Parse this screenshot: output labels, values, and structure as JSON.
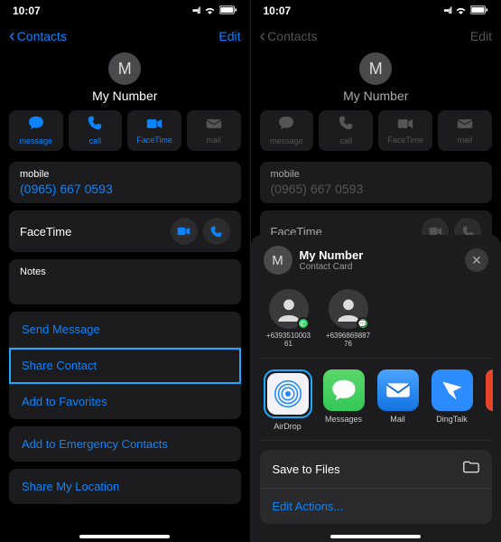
{
  "left": {
    "status": {
      "time": "10:07"
    },
    "nav": {
      "back": "Contacts",
      "edit": "Edit"
    },
    "avatar_initial": "M",
    "title": "My Number",
    "actions": {
      "message": "message",
      "call": "call",
      "facetime": "FaceTime",
      "mail": "mail"
    },
    "mobile": {
      "label": "mobile",
      "value": "(0965) 667 0593"
    },
    "facetime_label": "FaceTime",
    "notes_label": "Notes",
    "list1": {
      "send_message": "Send Message",
      "share_contact": "Share Contact",
      "add_favorites": "Add to Favorites"
    },
    "list2": {
      "emergency": "Add to Emergency Contacts"
    },
    "list3": {
      "share_location": "Share My Location"
    }
  },
  "right": {
    "status": {
      "time": "10:07"
    },
    "nav": {
      "back": "Contacts",
      "edit": "Edit"
    },
    "avatar_initial": "M",
    "title": "My Number",
    "actions": {
      "message": "message",
      "call": "call",
      "facetime": "FaceTime",
      "mail": "mail"
    },
    "mobile": {
      "label": "mobile",
      "value": "(0965) 667 0593"
    },
    "facetime_label": "FaceTime",
    "share": {
      "avatar_initial": "M",
      "title": "My Number",
      "subtitle": "Contact Card",
      "airdrop_contacts": [
        {
          "label": "+639351000361"
        },
        {
          "label": "+639686988776"
        }
      ],
      "apps": {
        "airdrop": "AirDrop",
        "messages": "Messages",
        "mail": "Mail",
        "dingtalk": "DingTalk"
      },
      "actions": {
        "save_files": "Save to Files",
        "edit_actions": "Edit Actions..."
      }
    }
  }
}
